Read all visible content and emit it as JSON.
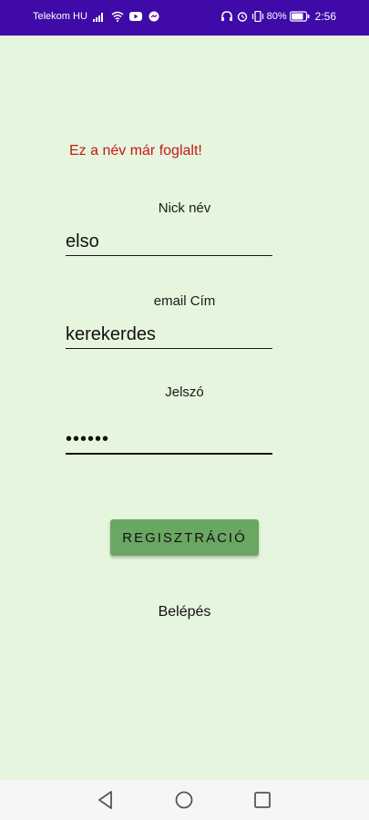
{
  "status_bar": {
    "carrier": "Telekom HU",
    "battery": "80%",
    "time": "2:56"
  },
  "form": {
    "error": "Ez a név már foglalt!",
    "nick_label": "Nick név",
    "nick_value": "elso",
    "email_label": "email Cím",
    "email_value": "kerekerdes",
    "password_label": "Jelszó",
    "password_value": "••••••",
    "register_button": "REGISZTRÁCIÓ",
    "login_link": "Belépés"
  },
  "colors": {
    "status_bar": "#3f0aa8",
    "background": "#e6f5de",
    "error": "#c41818",
    "button": "#6aa762"
  }
}
